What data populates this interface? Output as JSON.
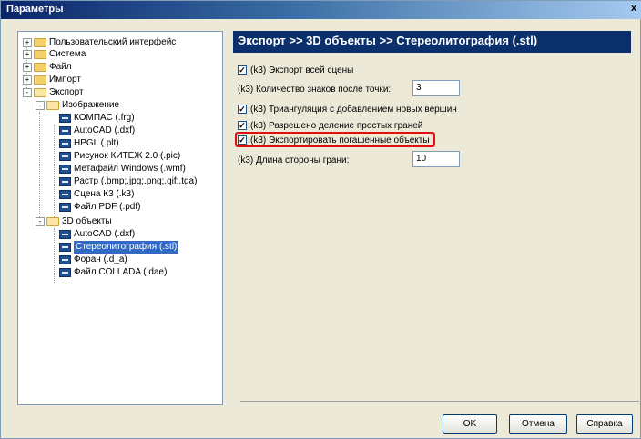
{
  "window": {
    "title": "Параметры",
    "close_glyph": "x"
  },
  "tree": [
    {
      "label": "Пользовательский интерфейс",
      "expander": "+"
    },
    {
      "label": "Система",
      "expander": "+"
    },
    {
      "label": "Файл",
      "expander": "+"
    },
    {
      "label": "Импорт",
      "expander": "+"
    },
    {
      "label": "Экспорт",
      "expander": "-"
    },
    {
      "label": "Изображение",
      "expander": "-"
    },
    {
      "label": "КОМПАС (.frg)"
    },
    {
      "label": "AutoCAD (.dxf)"
    },
    {
      "label": "HPGL (.plt)"
    },
    {
      "label": "Рисунок КИТЕЖ 2.0 (.pic)"
    },
    {
      "label": "Метафайл Windows (.wmf)"
    },
    {
      "label": "Растр (.bmp;.jpg;.png;.gif;.tga)"
    },
    {
      "label": "Сцена К3 (.k3)"
    },
    {
      "label": "Файл PDF (.pdf)"
    },
    {
      "label": "3D объекты",
      "expander": "-"
    },
    {
      "label": "AutoCAD (.dxf)"
    },
    {
      "label": "Стереолитография (.stl)",
      "selected": true
    },
    {
      "label": "Форан (.d_a)"
    },
    {
      "label": "Файл COLLADA (.dae)"
    }
  ],
  "panel": {
    "header": "Экспорт >> 3D объекты >> Стереолитография (.stl)",
    "export_all_scene": {
      "label": "(k3) Экспорт всей сцены",
      "checked": true
    },
    "decimal_places": {
      "label": "(k3) Количество знаков после точки:",
      "value": "3"
    },
    "triangulation": {
      "label": "(k3) Триангуляция с добавлением новых вершин",
      "checked": true
    },
    "split_faces": {
      "label": "(k3) Разрешено деление простых граней",
      "checked": true
    },
    "export_suppressed": {
      "label": "(k3) Экспортировать погашенные объекты",
      "checked": true
    },
    "face_length": {
      "label": "(k3) Длина стороны грани:",
      "value": "10"
    },
    "checkmark": "✓"
  },
  "buttons": {
    "ok": "OK",
    "cancel": "Отмена",
    "help": "Справка"
  }
}
